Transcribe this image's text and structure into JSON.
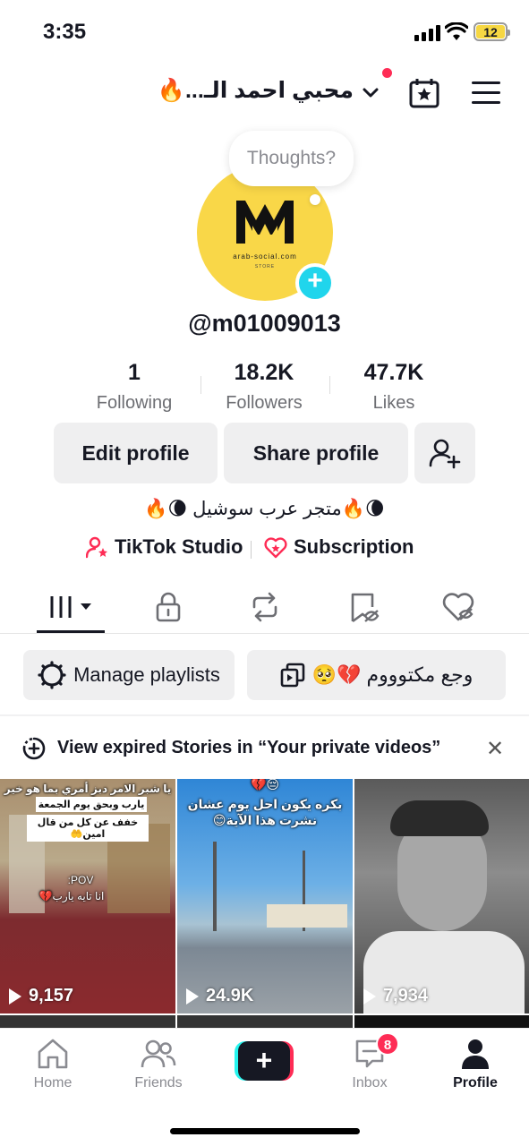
{
  "status_bar": {
    "time": "3:35",
    "battery": "12"
  },
  "header": {
    "account_name": "محبي احمد الـ...🔥"
  },
  "thought_bubble": {
    "text": "Thoughts?"
  },
  "avatar": {
    "logo_text": "arab-social.com",
    "logo_sub": "STORE"
  },
  "profile": {
    "username": "@m01009013"
  },
  "stats": [
    {
      "value": "1",
      "label": "Following"
    },
    {
      "value": "18.2K",
      "label": "Followers"
    },
    {
      "value": "47.7K",
      "label": "Likes"
    }
  ],
  "actions": {
    "edit": "Edit profile",
    "share": "Share profile"
  },
  "bio": "🌘🔥متجر عرب سوشيل 🌘🔥",
  "links": {
    "studio": "TikTok Studio",
    "subscription": "Subscription"
  },
  "playlists": {
    "manage": "Manage playlists",
    "playlist_name": "وجع مكتوووم 💔🥺"
  },
  "stories_banner": {
    "text": "View expired Stories in “Your private videos”"
  },
  "videos": [
    {
      "views": "9,157",
      "caption_top": "يا شبر الامر دبز أمري بما هو خير لي",
      "caption_mid": "يارب وبحق يوم الجمعة",
      "caption_mid2": "خفف عن كل من قال امين🤲",
      "caption_pov": "POV:",
      "caption_low": "انا تايه يارب💔"
    },
    {
      "views": "24.9K",
      "caption_top": "😔💔",
      "caption_mid": "بكره يكون احل يوم عشان",
      "caption_mid2": "نشرت هذا الآية😊"
    },
    {
      "views": "7,934"
    }
  ],
  "nav": {
    "home": "Home",
    "friends": "Friends",
    "inbox": "Inbox",
    "inbox_badge": "8",
    "profile": "Profile"
  },
  "colors": {
    "accent_pink": "#fe2c55",
    "accent_cyan": "#25f4ee",
    "avatar_yellow": "#f9d748"
  }
}
